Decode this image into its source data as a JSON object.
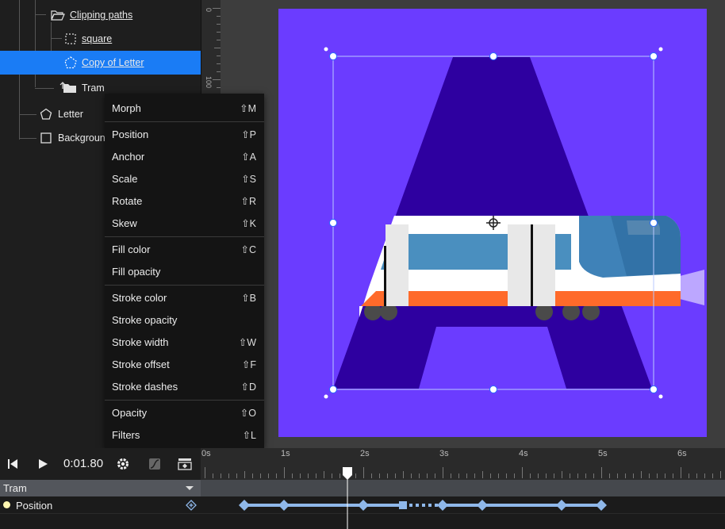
{
  "layers": {
    "items": [
      {
        "label": "Clipping paths",
        "icon": "folder-open-icon",
        "underline": true,
        "selected": false
      },
      {
        "label": "square",
        "icon": "dashed-square-icon",
        "underline": true,
        "selected": false
      },
      {
        "label": "Copy of Letter",
        "icon": "dashed-pentagon-icon",
        "underline": true,
        "selected": true
      },
      {
        "label": "Tram",
        "icon": "folder-icon",
        "underline": false,
        "selected": false
      },
      {
        "label": "Letter",
        "icon": "pentagon-icon",
        "underline": false,
        "selected": false
      },
      {
        "label": "Background",
        "icon": "square-icon",
        "underline": false,
        "selected": false
      }
    ]
  },
  "ruler": {
    "labels": [
      "0",
      "100"
    ]
  },
  "context_menu": {
    "items": [
      {
        "label": "Morph",
        "shortcut": "⇧M"
      },
      {
        "label": "Position",
        "shortcut": "⇧P"
      },
      {
        "label": "Anchor",
        "shortcut": "⇧A"
      },
      {
        "label": "Scale",
        "shortcut": "⇧S"
      },
      {
        "label": "Rotate",
        "shortcut": "⇧R"
      },
      {
        "label": "Skew",
        "shortcut": "⇧K"
      },
      {
        "label": "Fill color",
        "shortcut": "⇧C"
      },
      {
        "label": "Fill opacity",
        "shortcut": ""
      },
      {
        "label": "Stroke color",
        "shortcut": "⇧B"
      },
      {
        "label": "Stroke opacity",
        "shortcut": ""
      },
      {
        "label": "Stroke width",
        "shortcut": "⇧W"
      },
      {
        "label": "Stroke offset",
        "shortcut": "⇧F"
      },
      {
        "label": "Stroke dashes",
        "shortcut": "⇧D"
      },
      {
        "label": "Opacity",
        "shortcut": "⇧O"
      },
      {
        "label": "Filters",
        "shortcut": "⇧L"
      }
    ]
  },
  "timeline": {
    "current_time": "0:01.80",
    "ruler_labels": [
      "0s",
      "1s",
      "2s",
      "3s",
      "4s",
      "5s",
      "6s"
    ],
    "track_name": "Tram",
    "property_name": "Position",
    "playhead_seconds": 1.8,
    "keyframes_seconds": [
      0.5,
      1.0,
      2.0,
      2.5,
      3.0,
      3.5,
      4.5,
      5.0
    ]
  },
  "colors": {
    "accent": "#1a7cf5",
    "artboard": "#6b3cff",
    "letter": "#2e00a0",
    "keyframe": "#8fb8ea"
  }
}
